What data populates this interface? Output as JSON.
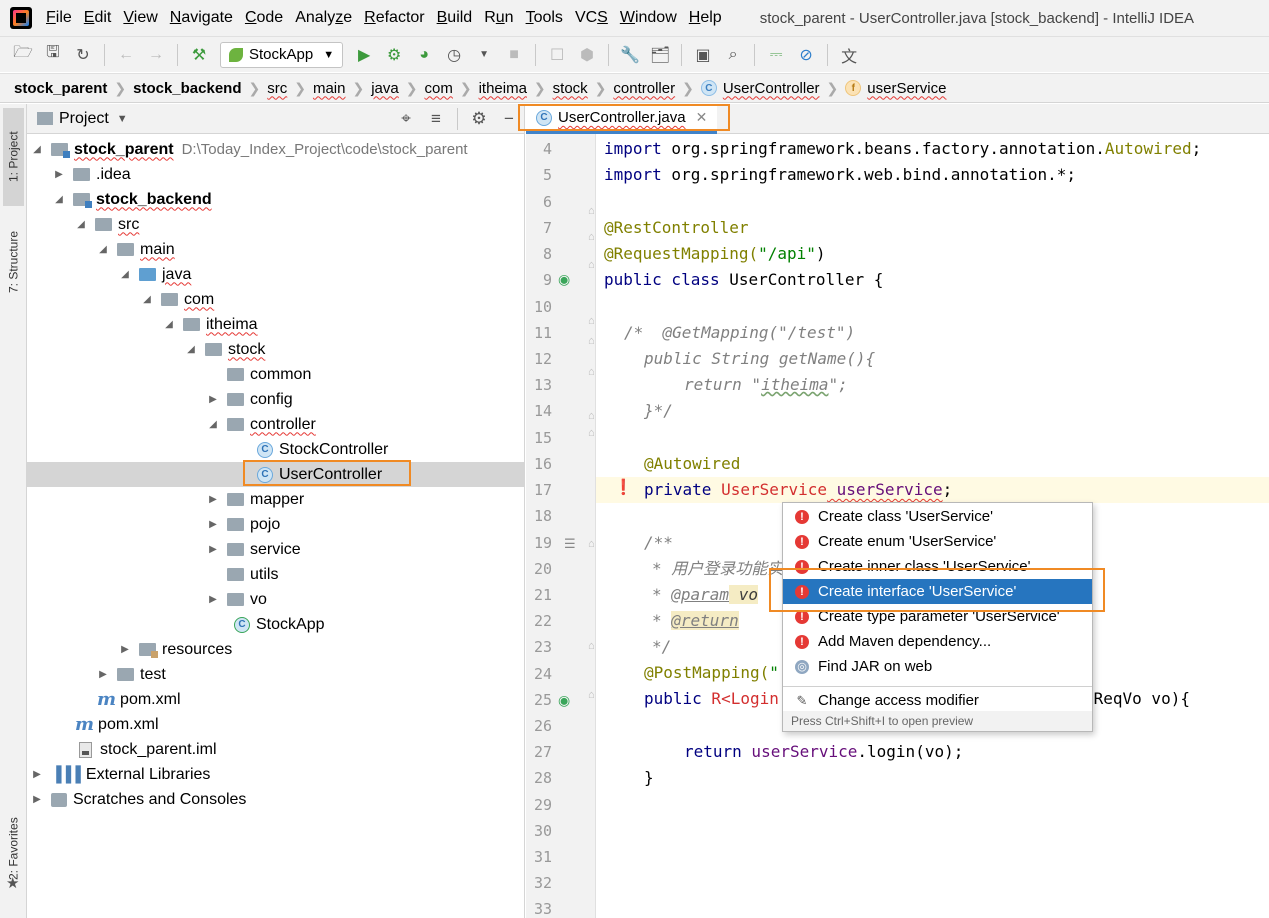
{
  "menubar": {
    "items": [
      {
        "pre": "",
        "u": "F",
        "post": "ile"
      },
      {
        "pre": "",
        "u": "E",
        "post": "dit"
      },
      {
        "pre": "",
        "u": "V",
        "post": "iew"
      },
      {
        "pre": "",
        "u": "N",
        "post": "avigate"
      },
      {
        "pre": "",
        "u": "C",
        "post": "ode"
      },
      {
        "pre": "Analy",
        "u": "z",
        "post": "e"
      },
      {
        "pre": "",
        "u": "R",
        "post": "efactor"
      },
      {
        "pre": "",
        "u": "B",
        "post": "uild"
      },
      {
        "pre": "R",
        "u": "u",
        "post": "n"
      },
      {
        "pre": "",
        "u": "T",
        "post": "ools"
      },
      {
        "pre": "VC",
        "u": "S",
        "post": ""
      },
      {
        "pre": "",
        "u": "W",
        "post": "indow"
      },
      {
        "pre": "",
        "u": "H",
        "post": "elp"
      }
    ],
    "window_title": "stock_parent - UserController.java [stock_backend] - IntelliJ IDEA"
  },
  "toolbar": {
    "run_config": "StockApp"
  },
  "breadcrumb": [
    {
      "label": "stock_parent",
      "bold": true
    },
    {
      "label": "stock_backend",
      "bold": true
    },
    {
      "label": "src"
    },
    {
      "label": "main"
    },
    {
      "label": "java"
    },
    {
      "label": "com"
    },
    {
      "label": "itheima"
    },
    {
      "label": "stock"
    },
    {
      "label": "controller"
    },
    {
      "label": "UserController",
      "badge": "C"
    },
    {
      "label": "userService",
      "badge": "f"
    }
  ],
  "left_strip": {
    "project_tab": "1: Project",
    "structure_tab": "7: Structure",
    "favorites_tab": "2: Favorites"
  },
  "project_panel": {
    "title": "Project",
    "tree": [
      {
        "label": "stock_parent",
        "path": "D:\\Today_Index_Project\\code\\stock_parent",
        "bold": true
      },
      {
        "label": ".idea"
      },
      {
        "label": "stock_backend",
        "bold": true
      },
      {
        "label": "src"
      },
      {
        "label": "main"
      },
      {
        "label": "java"
      },
      {
        "label": "com"
      },
      {
        "label": "itheima"
      },
      {
        "label": "stock"
      },
      {
        "label": "common"
      },
      {
        "label": "config"
      },
      {
        "label": "controller"
      },
      {
        "label": "StockController"
      },
      {
        "label": "UserController"
      },
      {
        "label": "mapper"
      },
      {
        "label": "pojo"
      },
      {
        "label": "service"
      },
      {
        "label": "utils"
      },
      {
        "label": "vo"
      },
      {
        "label": "StockApp"
      },
      {
        "label": "resources"
      },
      {
        "label": "test"
      },
      {
        "label": "pom.xml"
      },
      {
        "label": "pom.xml"
      },
      {
        "label": "stock_parent.iml"
      },
      {
        "label": "External Libraries"
      },
      {
        "label": "Scratches and Consoles"
      }
    ]
  },
  "editor": {
    "tab": "UserController.java",
    "line_numbers": [
      "4",
      "5",
      "6",
      "7",
      "8",
      "9",
      "10",
      "11",
      "12",
      "13",
      "14",
      "15",
      "16",
      "17",
      "18",
      "19",
      "20",
      "21",
      "22",
      "23",
      "24",
      "25",
      "26",
      "27",
      "28",
      "29",
      "30",
      "31",
      "32",
      "33"
    ],
    "code": {
      "l4a": "import",
      "l4b": " org.springframework.beans.factory.annotation.",
      "l4c": "Autowired",
      "l4d": ";",
      "l5a": "import",
      "l5b": " org.springframework.web.bind.annotation.*;",
      "l7": "@RestController",
      "l8a": "@RequestMapping(",
      "l8b": "\"/api\"",
      "l8c": ")",
      "l9a": "public class",
      "l9b": " UserController {",
      "l11": "/*  @GetMapping(\"/test\")",
      "l12": "public String getName(){",
      "l13a": "return \"",
      "l13b": "itheima",
      "l13c": "\";",
      "l14": "}*/",
      "l16": "@Autowired",
      "l17a": "private",
      "l17b": " UserService",
      "l17c": " userService",
      "l17d": ";",
      "l19": "/**",
      "l20": "* 用户登录功能实",
      "l21a": "* ",
      "l21b": "@param",
      "l21c": " vo",
      "l22a": "* ",
      "l22b": "@return",
      "l23": "*/",
      "l24a": "@PostMapping(",
      "l24b": "\"",
      "l25a": "public",
      "l25b": " R<Login",
      "l25c": "nReqVo vo){",
      "l27a": "return",
      "l27b": " userService",
      "l27c": ".login(vo);",
      "l28": "}"
    }
  },
  "intention_popup": {
    "items": [
      "Create class 'UserService'",
      "Create enum 'UserService'",
      "Create inner class 'UserService'",
      "Create interface 'UserService'",
      "Create type parameter 'UserService'",
      "Add Maven dependency...",
      "Find JAR on web",
      "Change access modifier"
    ],
    "hint": "Press Ctrl+Shift+I to open preview"
  }
}
